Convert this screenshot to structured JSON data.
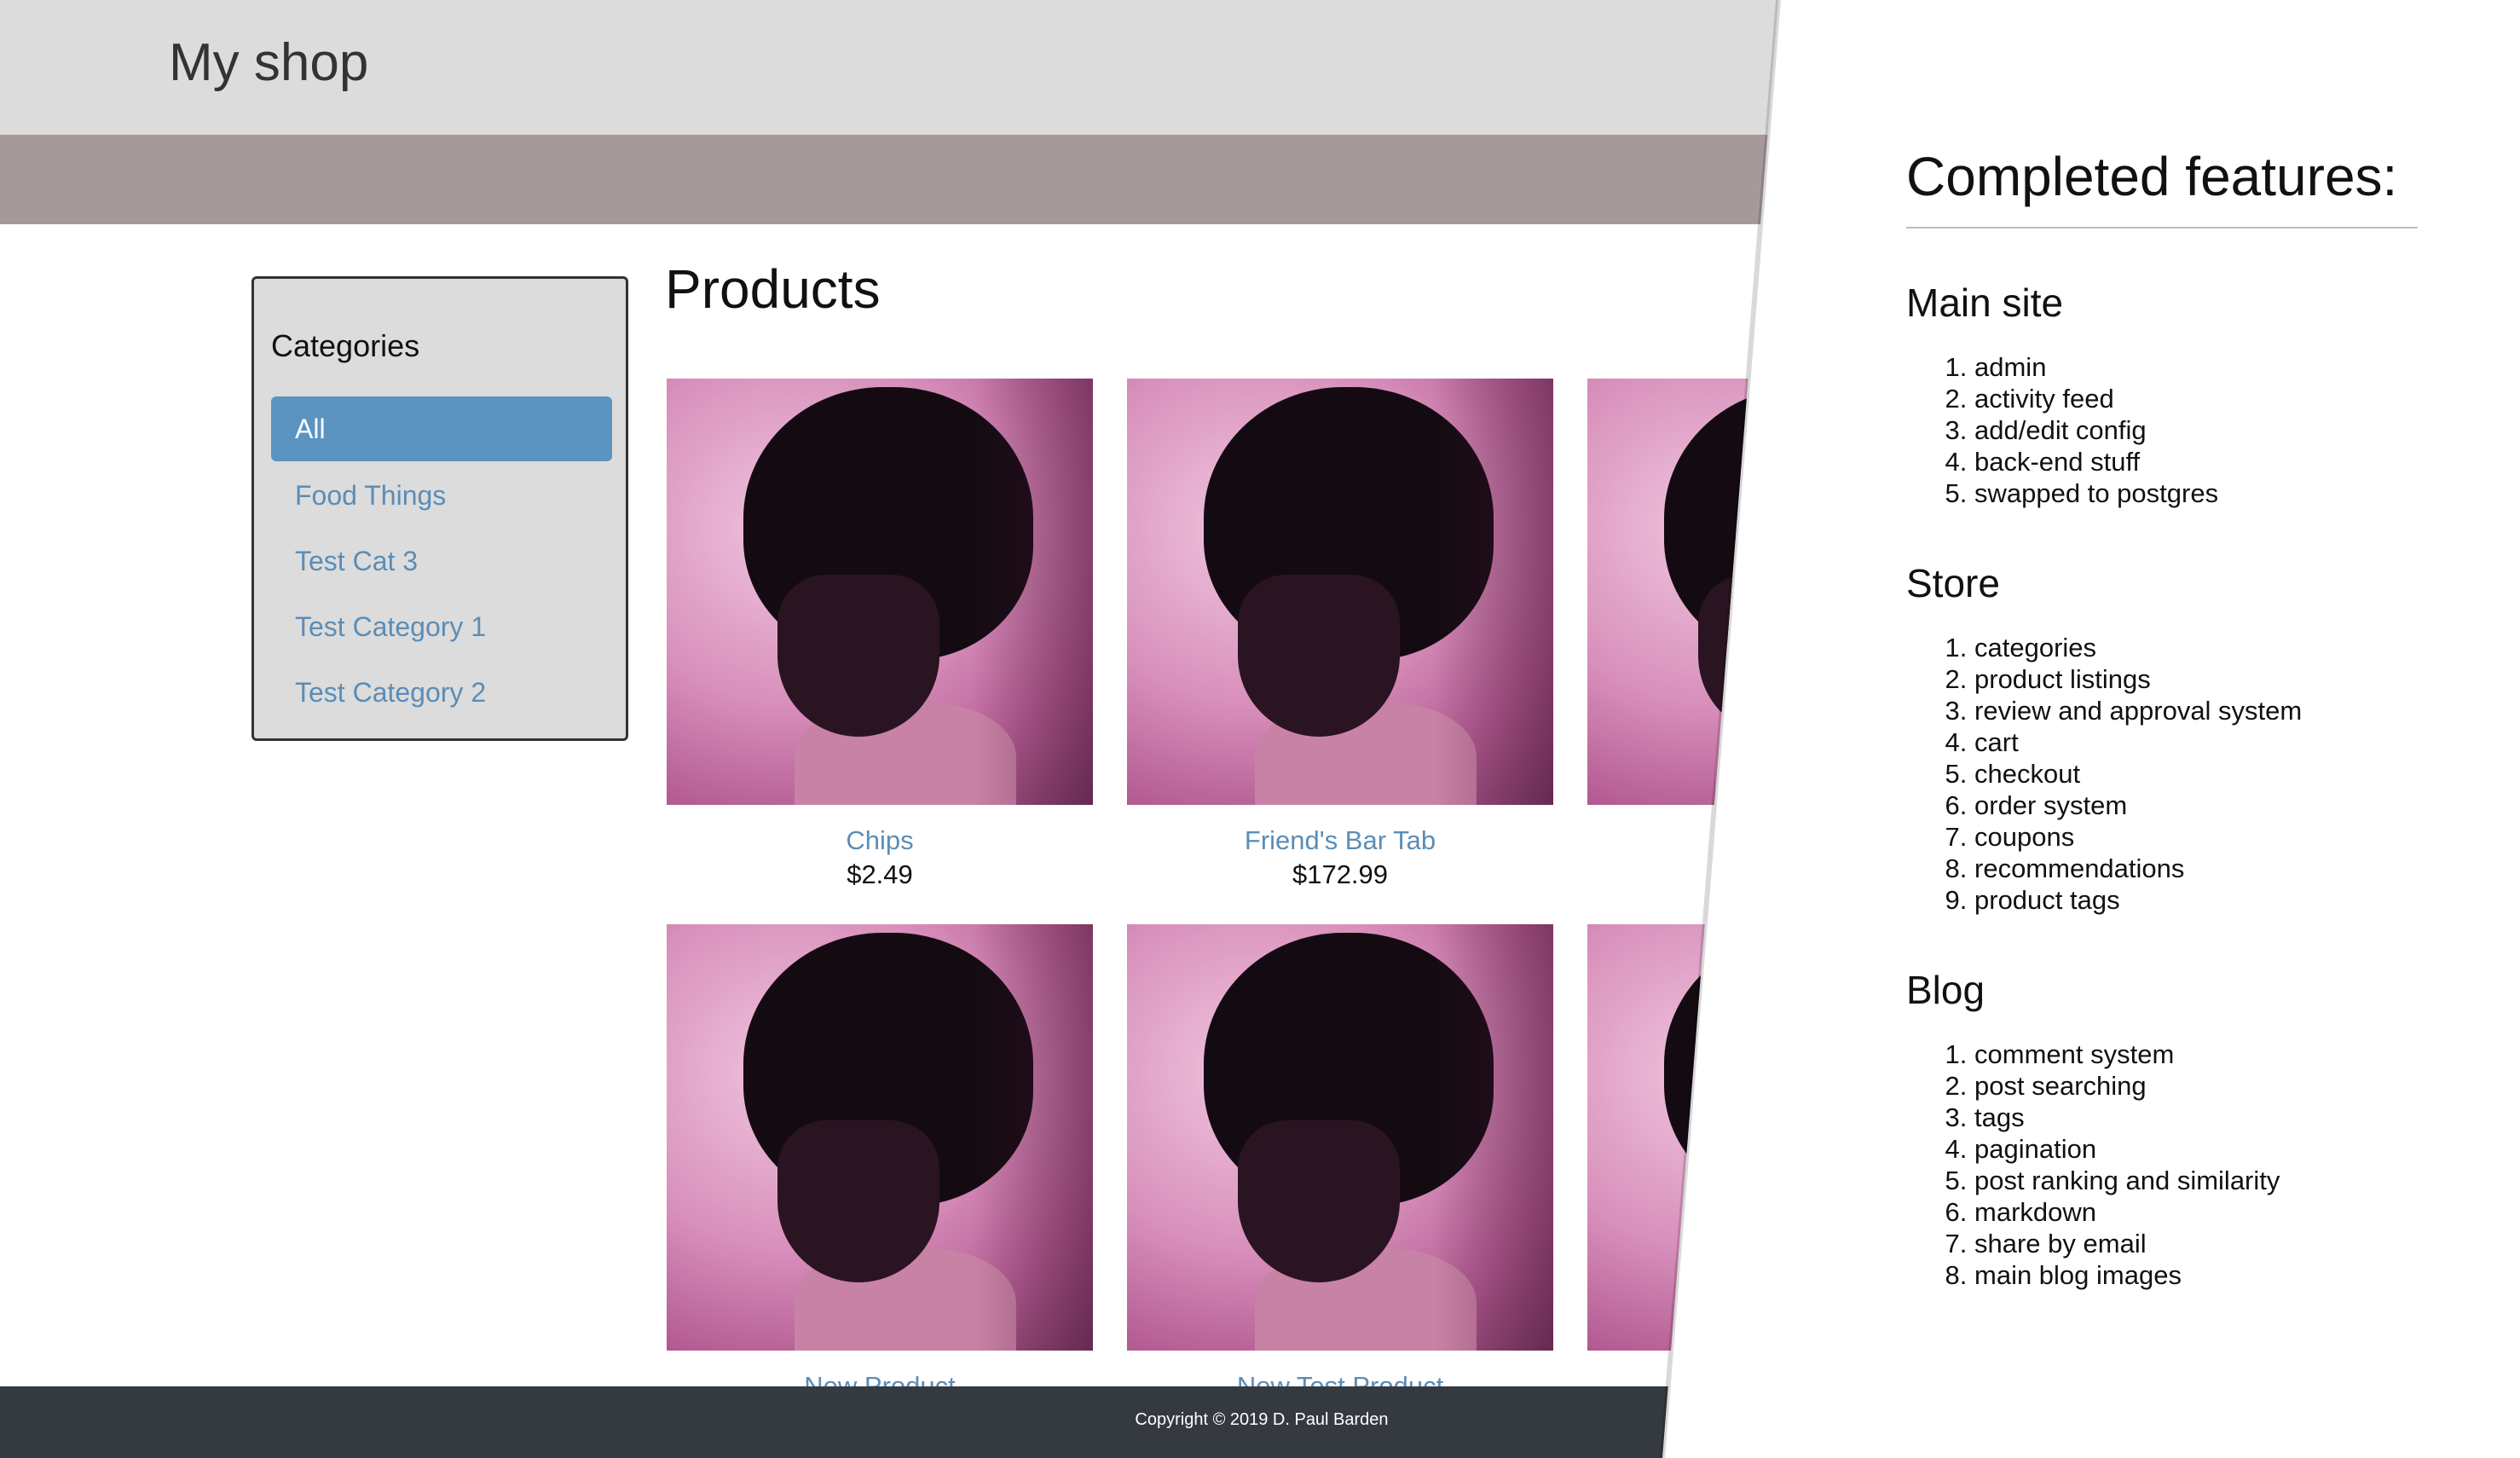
{
  "header": {
    "brand": "My shop"
  },
  "sidebar": {
    "title": "Categories",
    "items": [
      {
        "label": "All",
        "active": true
      },
      {
        "label": "Food Things",
        "active": false
      },
      {
        "label": "Test Cat 3",
        "active": false
      },
      {
        "label": "Test Category 1",
        "active": false
      },
      {
        "label": "Test Category 2",
        "active": false
      }
    ]
  },
  "main": {
    "title": "Products",
    "products": [
      {
        "name": "Chips",
        "price": "$2.49"
      },
      {
        "name": "Friend's Bar Tab",
        "price": "$172.99"
      },
      {
        "name": "",
        "price": ""
      },
      {
        "name": "New Product",
        "price": ""
      },
      {
        "name": "New Test Product",
        "price": ""
      },
      {
        "name": "",
        "price": ""
      }
    ]
  },
  "footer": {
    "copyright": "Copyright © 2019 D. Paul Barden"
  },
  "features": {
    "title": "Completed features:",
    "sections": [
      {
        "heading": "Main site",
        "items": [
          "admin",
          "activity feed",
          "add/edit config",
          "back-end stuff",
          "swapped to postgres"
        ]
      },
      {
        "heading": "Store",
        "items": [
          "categories",
          "product listings",
          "review and approval system",
          "cart",
          "checkout",
          "order system",
          "coupons",
          "recommendations",
          "product tags"
        ]
      },
      {
        "heading": "Blog",
        "items": [
          "comment system",
          "post searching",
          "tags",
          "pagination",
          "post ranking and similarity",
          "markdown",
          "share by email",
          "main blog images"
        ]
      }
    ]
  },
  "colors": {
    "topbar": "#dcdcdc",
    "band": "#a69999",
    "link": "#5b8db6",
    "active": "#5b94c0",
    "footer": "#343a40"
  }
}
